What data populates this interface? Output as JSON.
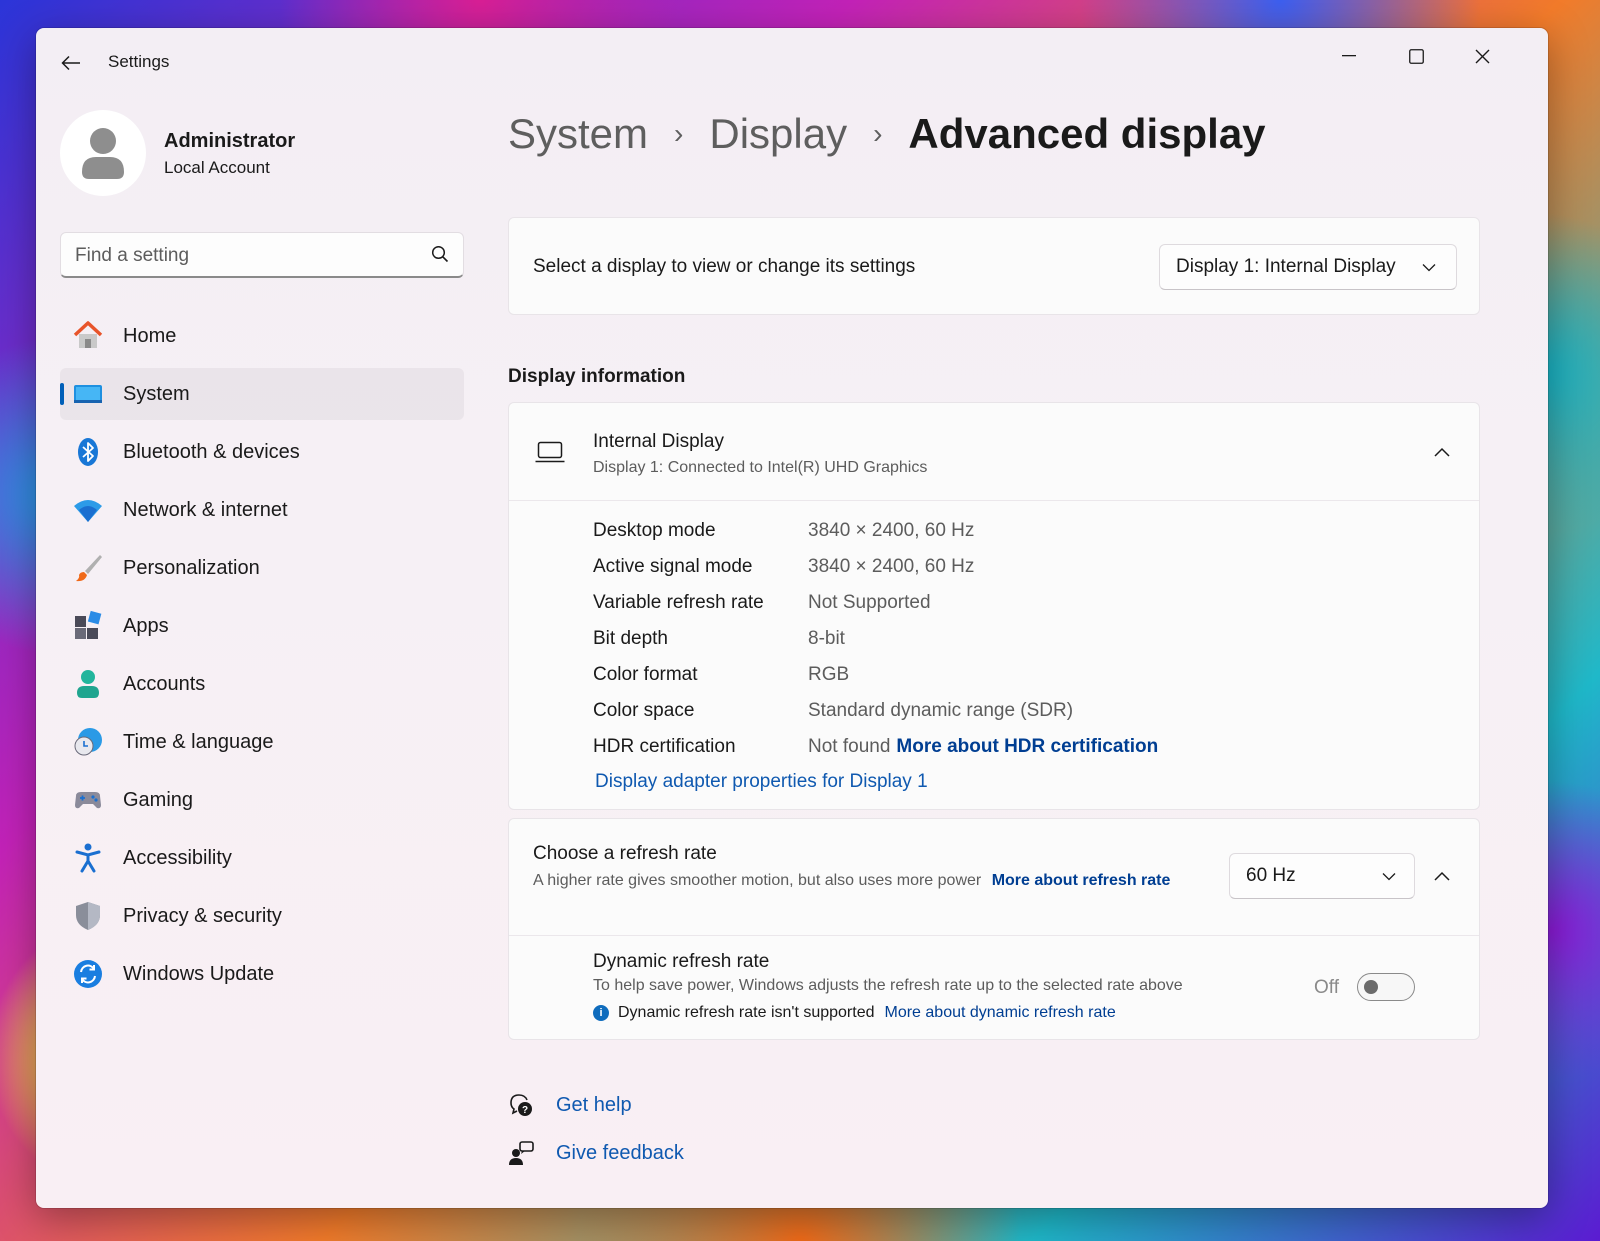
{
  "window": {
    "app_title": "Settings"
  },
  "user": {
    "name": "Administrator",
    "account_type": "Local Account"
  },
  "search": {
    "placeholder": "Find a setting"
  },
  "sidebar": {
    "items": [
      {
        "label": "Home",
        "icon": "home-icon",
        "active": false
      },
      {
        "label": "System",
        "icon": "system-icon",
        "active": true
      },
      {
        "label": "Bluetooth & devices",
        "icon": "bluetooth-icon",
        "active": false
      },
      {
        "label": "Network & internet",
        "icon": "wifi-icon",
        "active": false
      },
      {
        "label": "Personalization",
        "icon": "brush-icon",
        "active": false
      },
      {
        "label": "Apps",
        "icon": "apps-icon",
        "active": false
      },
      {
        "label": "Accounts",
        "icon": "accounts-icon",
        "active": false
      },
      {
        "label": "Time & language",
        "icon": "clock-globe-icon",
        "active": false
      },
      {
        "label": "Gaming",
        "icon": "gamepad-icon",
        "active": false
      },
      {
        "label": "Accessibility",
        "icon": "accessibility-icon",
        "active": false
      },
      {
        "label": "Privacy & security",
        "icon": "shield-icon",
        "active": false
      },
      {
        "label": "Windows Update",
        "icon": "update-icon",
        "active": false
      }
    ]
  },
  "breadcrumb": {
    "items": [
      "System",
      "Display"
    ],
    "current": "Advanced display"
  },
  "display_select": {
    "label": "Select a display to view or change its settings",
    "selected": "Display 1: Internal Display"
  },
  "display_info": {
    "section_title": "Display information",
    "name": "Internal Display",
    "subtitle": "Display 1: Connected to Intel(R) UHD Graphics",
    "properties": [
      {
        "label": "Desktop mode",
        "value": "3840 × 2400, 60 Hz"
      },
      {
        "label": "Active signal mode",
        "value": "3840 × 2400, 60 Hz"
      },
      {
        "label": "Variable refresh rate",
        "value": "Not Supported"
      },
      {
        "label": "Bit depth",
        "value": "8-bit"
      },
      {
        "label": "Color format",
        "value": "RGB"
      },
      {
        "label": "Color space",
        "value": "Standard dynamic range (SDR)"
      },
      {
        "label": "HDR certification",
        "value": "Not found",
        "link": "More about HDR certification"
      }
    ],
    "adapter_link": "Display adapter properties for Display 1"
  },
  "refresh_rate": {
    "title": "Choose a refresh rate",
    "description": "A higher rate gives smoother motion, but also uses more power",
    "link": "More about refresh rate",
    "selected": "60 Hz",
    "dynamic": {
      "title": "Dynamic refresh rate",
      "description": "To help save power, Windows adjusts the refresh rate up to the selected rate above",
      "note": "Dynamic refresh rate isn't supported",
      "note_link": "More about dynamic refresh rate",
      "toggle_state": "Off"
    }
  },
  "help": {
    "get_help": "Get help",
    "give_feedback": "Give feedback"
  },
  "colors": {
    "accent": "#005fb8",
    "link": "#003e92"
  }
}
